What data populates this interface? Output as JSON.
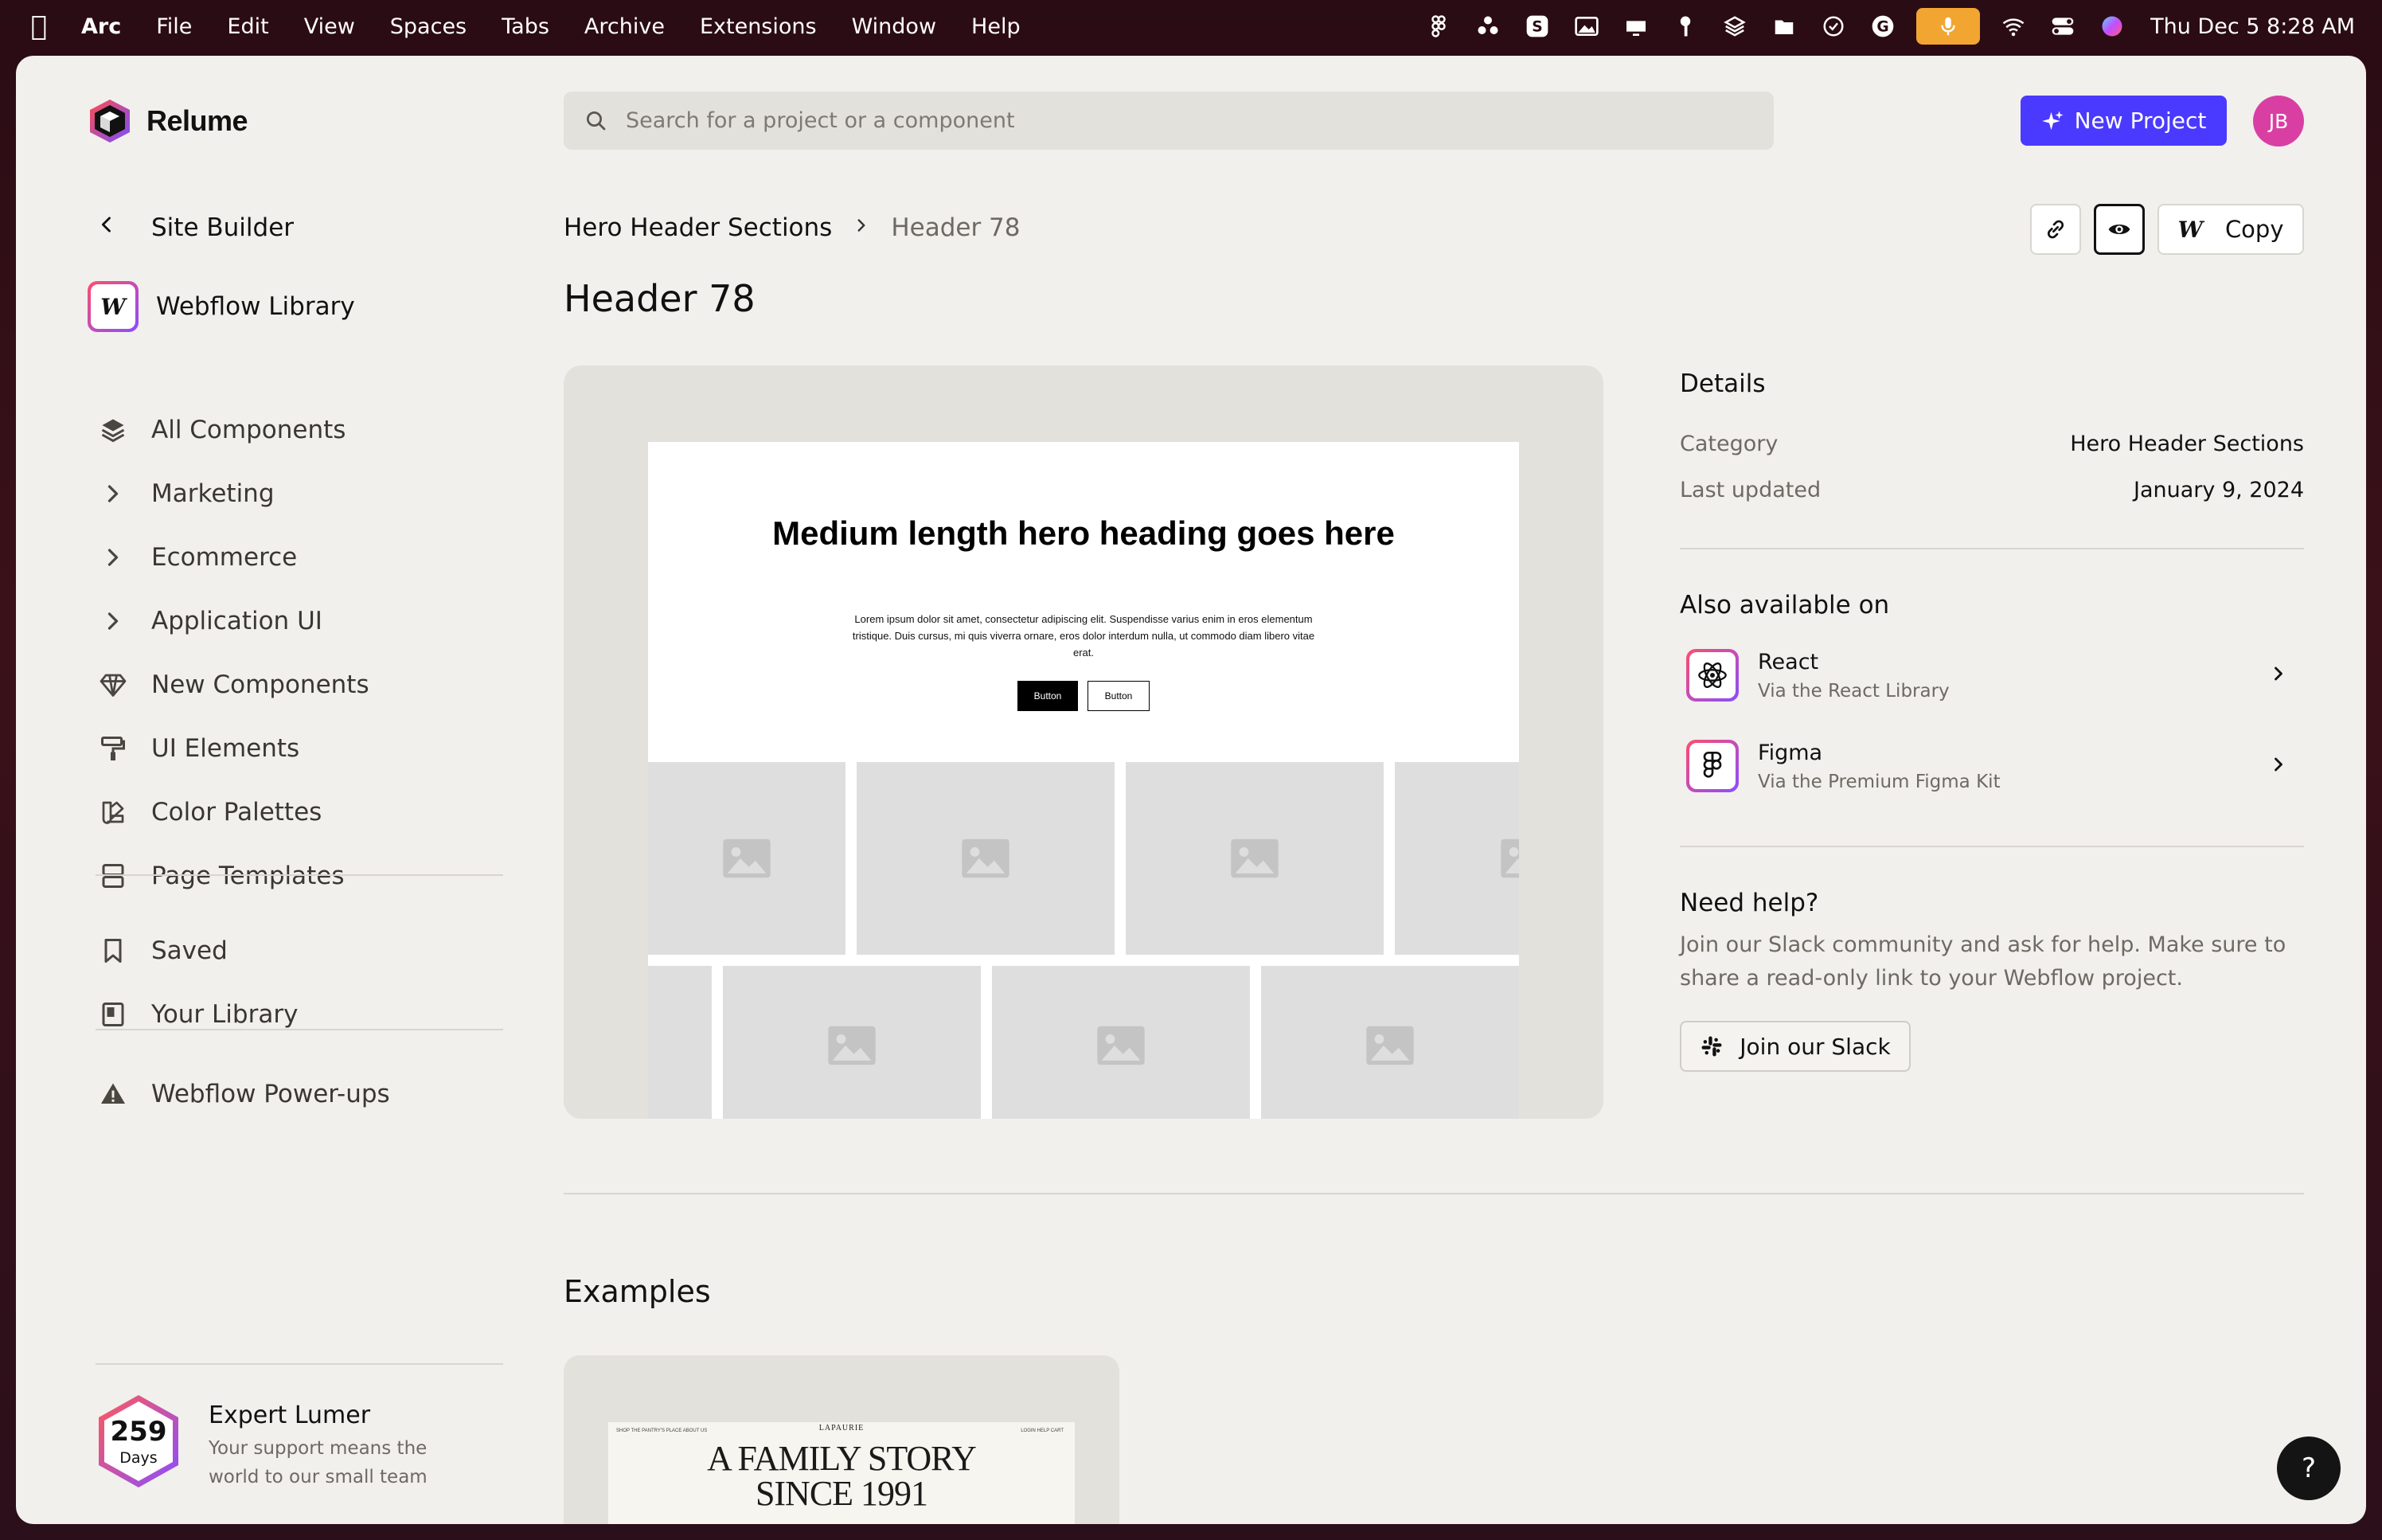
{
  "menubar": {
    "app_name": "Arc",
    "items": [
      "File",
      "Edit",
      "View",
      "Spaces",
      "Tabs",
      "Archive",
      "Extensions",
      "Window",
      "Help"
    ],
    "clock": "Thu Dec 5  8:28 AM",
    "status_icons": [
      "figma-icon",
      "dots-icon",
      "skype-icon",
      "image-icon",
      "cast-icon",
      "key-icon",
      "layers-icon",
      "folder-icon",
      "check-circle-icon",
      "g-icon",
      "microphone-icon",
      "wifi-icon",
      "control-center-icon",
      "siri-icon"
    ],
    "mic_color": "#f2a531"
  },
  "app": {
    "logo_text": "Relume",
    "search": {
      "placeholder": "Search for a project or a component",
      "value": ""
    },
    "new_project_label": "New Project",
    "accent": "#4a3aff",
    "avatar_initials": "JB",
    "avatar_color": "#d93fa3"
  },
  "sidebar": {
    "back_label": "Site Builder",
    "library_label": "Webflow Library",
    "library_icon_glyph": "W",
    "items": [
      {
        "label": "All Components",
        "icon": "layers-icon"
      },
      {
        "label": "Marketing",
        "icon": "chevron-right-icon"
      },
      {
        "label": "Ecommerce",
        "icon": "chevron-right-icon"
      },
      {
        "label": "Application UI",
        "icon": "chevron-right-icon"
      },
      {
        "label": "New Components",
        "icon": "diamond-icon"
      },
      {
        "label": "UI Elements",
        "icon": "paint-roller-icon"
      },
      {
        "label": "Color Palettes",
        "icon": "swatch-icon"
      },
      {
        "label": "Page Templates",
        "icon": "template-icon"
      }
    ],
    "secondary_items": [
      {
        "label": "Saved",
        "icon": "bookmark-icon"
      },
      {
        "label": "Your Library",
        "icon": "library-icon"
      }
    ],
    "powerups_label": "Webflow Power-ups",
    "lumer": {
      "days": "259",
      "days_unit": "Days",
      "title": "Expert Lumer",
      "subtitle": "Your support means the world to our small team"
    }
  },
  "main": {
    "breadcrumb": {
      "parent": "Hero Header Sections",
      "current": "Header 78"
    },
    "title": "Header 78",
    "copy_label": "Copy",
    "copy_glyph": "W",
    "preview": {
      "heading": "Medium length hero heading goes here",
      "body": "Lorem ipsum dolor sit amet, consectetur adipiscing elit. Suspendisse varius enim in eros elementum tristique. Duis cursus, mi quis viverra ornare, eros dolor interdum nulla, ut commodo diam libero vitae erat.",
      "button_primary": "Button",
      "button_secondary": "Button"
    },
    "details": {
      "title": "Details",
      "rows": [
        {
          "key": "Category",
          "value": "Hero Header Sections"
        },
        {
          "key": "Last updated",
          "value": "January 9, 2024"
        }
      ]
    },
    "also_available": {
      "title": "Also available on",
      "items": [
        {
          "name": "React",
          "sub": "Via the React Library",
          "icon": "react-icon"
        },
        {
          "name": "Figma",
          "sub": "Via the Premium Figma Kit",
          "icon": "figma-icon"
        }
      ]
    },
    "help": {
      "title": "Need help?",
      "text": "Join our Slack community and ask for help. Make sure to share a read-only link to your Webflow project.",
      "button": "Join our Slack"
    },
    "examples": {
      "title": "Examples",
      "card": {
        "brand": "LAPAURIE",
        "nav_left": "SHOP   THE PANTRY'S PLACE   ABOUT US",
        "nav_right": "LOGIN   HELP   CART",
        "heading_line1": "A FAMILY STORY",
        "heading_line2": "SINCE 1991"
      }
    },
    "help_fab": "?"
  }
}
